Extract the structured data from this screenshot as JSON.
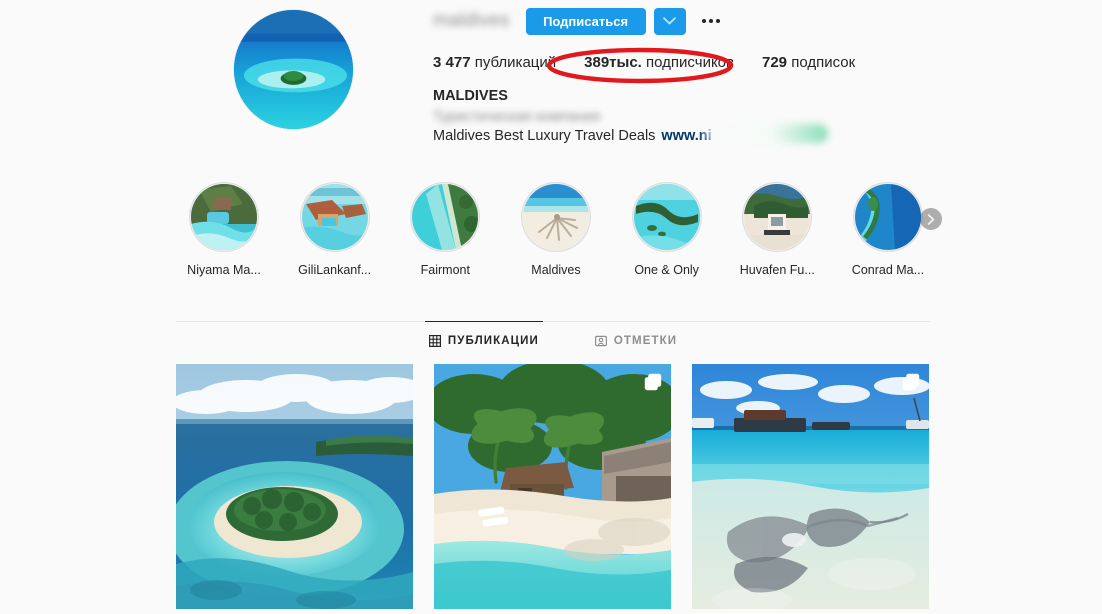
{
  "profile": {
    "username": "maldives",
    "username_blurred": true,
    "follow_button": "Подписаться",
    "chevron_icon": "chevron-down-icon",
    "more_options_icon": "ellipsis-icon",
    "stats": [
      {
        "value": "3 477",
        "label": "публикаций",
        "name": "posts-count"
      },
      {
        "value": "389тыс.",
        "label": "подписчиков",
        "name": "followers-count"
      },
      {
        "value": "729",
        "label": "подписок",
        "name": "following-count"
      }
    ],
    "bio_name": "MALDIVES",
    "bio_category": "Туристическая компания",
    "bio_category_blurred": true,
    "bio_description": "Maldives Best Luxury Travel Deals",
    "bio_link": "www.ni",
    "bio_link_blurred": true
  },
  "annotation": {
    "type": "ellipse",
    "color": "#e2191c",
    "target": "389тыс. подписчиков"
  },
  "highlights": [
    {
      "label": "Niyama Ma...",
      "icon": "highlight-niyama"
    },
    {
      "label": "GiliLankanf...",
      "icon": "highlight-gililankanfushi"
    },
    {
      "label": "Fairmont",
      "icon": "highlight-fairmont"
    },
    {
      "label": "Maldives",
      "icon": "highlight-maldives"
    },
    {
      "label": "One & Only",
      "icon": "highlight-one-and-only"
    },
    {
      "label": "Huvafen Fu...",
      "icon": "highlight-huvafen"
    },
    {
      "label": "Conrad Ma...",
      "icon": "highlight-conrad"
    }
  ],
  "highlights_next_icon": "chevron-right-icon",
  "tabs": [
    {
      "label": "ПУБЛИКАЦИИ",
      "icon": "grid-icon",
      "active": true
    },
    {
      "label": "ОТМЕТКИ",
      "icon": "tagged-person-icon",
      "active": false
    }
  ],
  "posts": [
    {
      "name": "post-aerial-island",
      "multi": false,
      "alt": "Аэрофотоснимок маленького тропического острова с белым пляжем и бирюзовым рифом"
    },
    {
      "name": "post-palm-beach-villas",
      "multi": true,
      "alt": "Пляж с пальмами и виллами с соломенными крышами"
    },
    {
      "name": "post-stingrays",
      "multi": true,
      "alt": "Скаты в прозрачной мелкой воде, лодки на горизонте"
    }
  ],
  "colors": {
    "background": "#fafafa",
    "accent_blue": "#1a9ae8",
    "annotation_red": "#e2191c",
    "text_primary": "#262626",
    "text_secondary": "#8e8e8e",
    "link": "#00376b"
  }
}
